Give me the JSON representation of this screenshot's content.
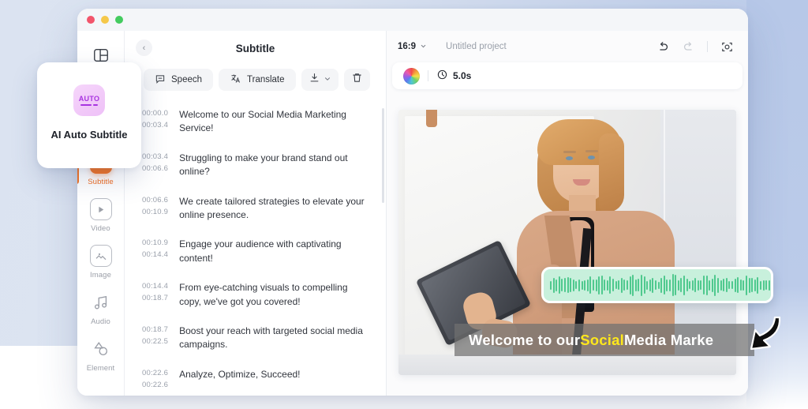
{
  "window": {
    "traffic_lights": [
      "close",
      "minimize",
      "maximize"
    ]
  },
  "floating_card": {
    "badge_text": "AUTO",
    "label": "AI Auto Subtitle"
  },
  "rail": {
    "top_icon": "layout-panel-icon",
    "items": [
      {
        "label": "Subtitle",
        "icon": "subtitle-icon",
        "active": true
      },
      {
        "label": "Video",
        "icon": "video-play-icon",
        "active": false
      },
      {
        "label": "Image",
        "icon": "image-icon",
        "active": false
      },
      {
        "label": "Audio",
        "icon": "music-note-icon",
        "active": false
      },
      {
        "label": "Element",
        "icon": "shapes-icon",
        "active": false
      }
    ]
  },
  "subtitle_panel": {
    "back_icon": "chevron-left-icon",
    "title": "Subtitle",
    "buttons": {
      "speech": "Speech",
      "translate": "Translate",
      "download_icon": "download-icon",
      "download_chevron": "chevron-down-icon",
      "delete_icon": "trash-icon"
    },
    "rows": [
      {
        "start": "00:00.0",
        "end": "00:03.4",
        "text": "Welcome to our Social Media Marketing Service!"
      },
      {
        "start": "00:03.4",
        "end": "00:06.6",
        "text": "Struggling to make your brand stand out online?"
      },
      {
        "start": "00:06.6",
        "end": "00:10.9",
        "text": "We create tailored strategies to elevate your online presence."
      },
      {
        "start": "00:10.9",
        "end": "00:14.4",
        "text": "Engage your audience with captivating content!"
      },
      {
        "start": "00:14.4",
        "end": "00:18.7",
        "text": "From eye-catching visuals to compelling copy, we've got you covered!"
      },
      {
        "start": "00:18.7",
        "end": "00:22.5",
        "text": "Boost your reach with targeted social media campaigns."
      },
      {
        "start": "00:22.6",
        "end": "00:22.6",
        "text": "Analyze, Optimize, Succeed!"
      }
    ]
  },
  "preview": {
    "aspect_ratio": "16:9",
    "aspect_chevron": "chevron-down-icon",
    "project_name": "Untitled project",
    "undo_icon": "undo-icon",
    "redo_icon": "redo-icon",
    "fit_icon": "focus-frame-icon",
    "toolbar2": {
      "color_wheel_icon": "color-wheel-icon",
      "clock_icon": "clock-icon",
      "duration": "5.0s"
    },
    "caption": {
      "before": "Welcome to our ",
      "highlight": "Social",
      "after": " Media Marke"
    },
    "waveform": {
      "icon": "audio-waveform",
      "bar_count": 96
    }
  },
  "colors": {
    "accent_orange": "#f57322",
    "caption_highlight": "#ffe81c",
    "waveform_green": "#4fc98e",
    "waveform_bg": "#c8f0dc",
    "ai_badge_purple": "#a833e0"
  },
  "cursor": {
    "icon": "arrow-cursor-down-left"
  }
}
